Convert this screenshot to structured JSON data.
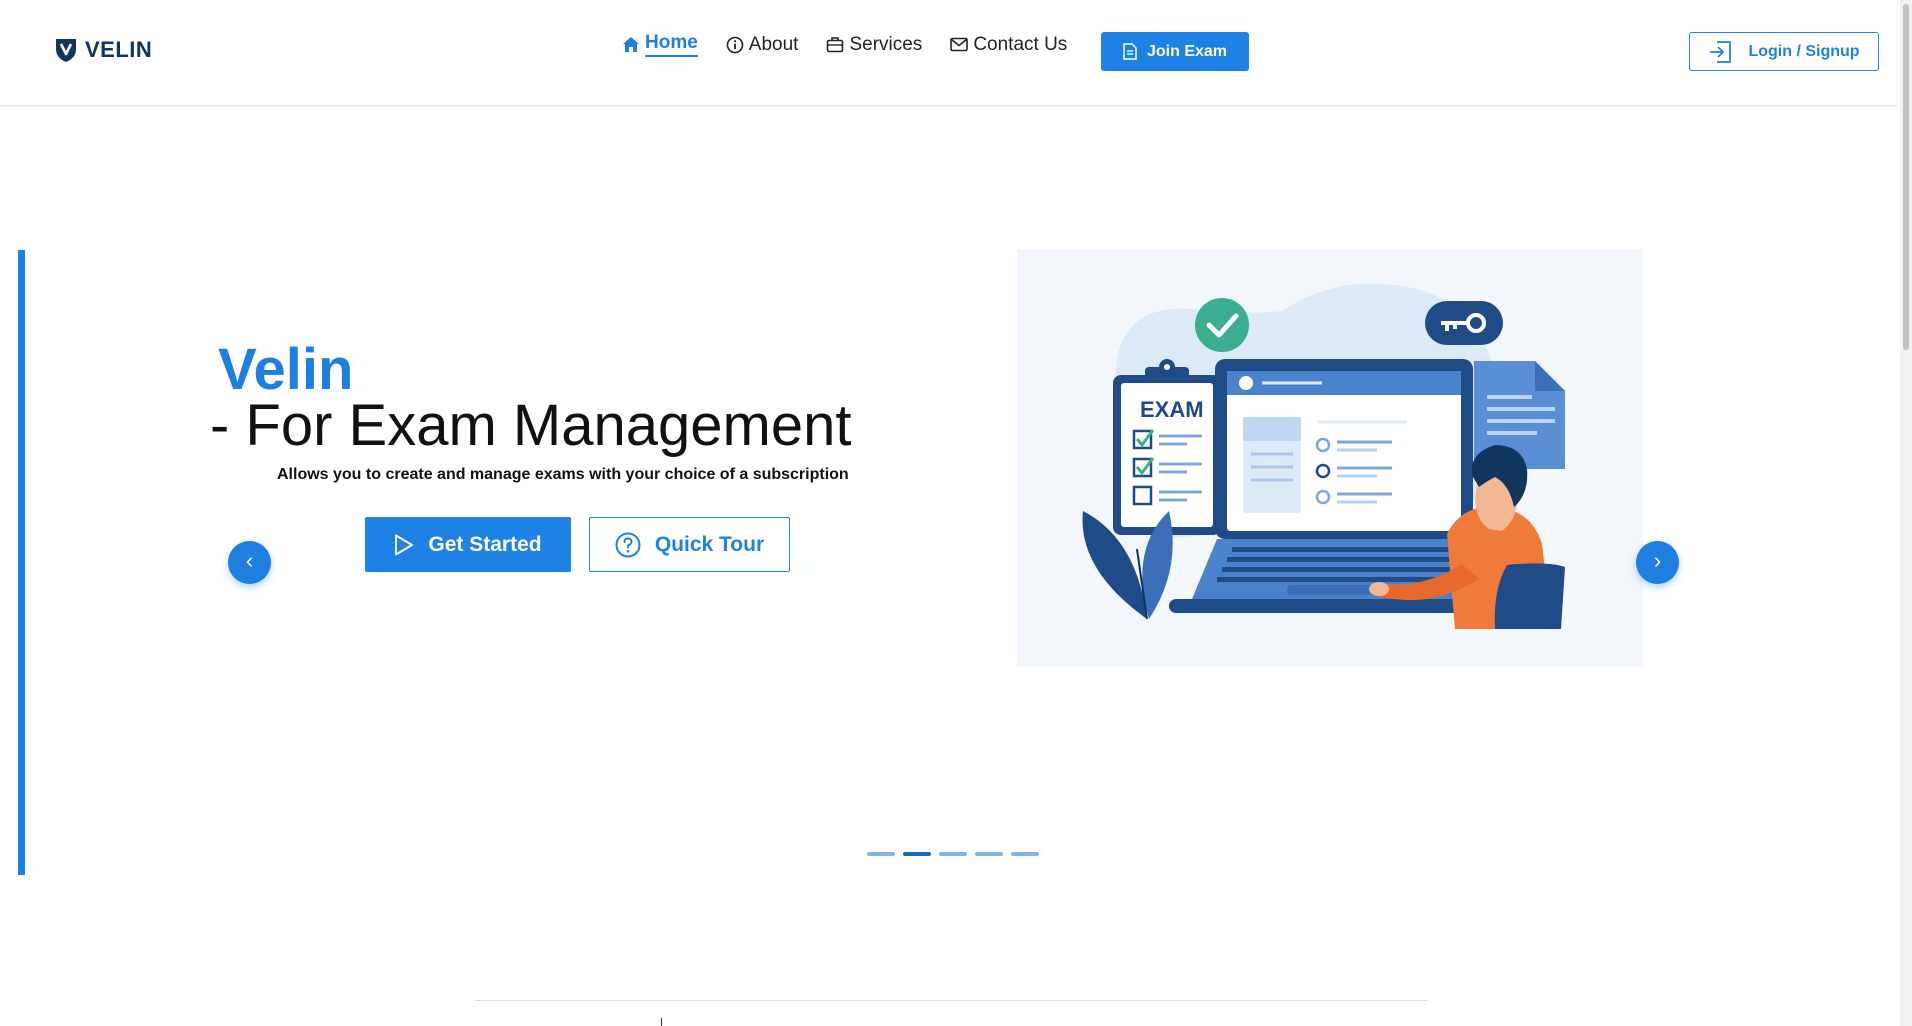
{
  "header": {
    "brand": "VELIN",
    "nav": [
      {
        "label": "Home",
        "icon": "home-icon",
        "active": true
      },
      {
        "label": "About",
        "icon": "info-icon",
        "active": false
      },
      {
        "label": "Services",
        "icon": "briefcase-icon",
        "active": false
      },
      {
        "label": "Contact Us",
        "icon": "envelope-icon",
        "active": false
      }
    ],
    "join_label": "Join Exam",
    "login_label": "Login / Signup"
  },
  "hero": {
    "title": "Velin",
    "subtitle": "- For Exam Management",
    "description": "Allows you to create and manage exams with your choice of a subscription",
    "primary_button": "Get Started",
    "secondary_button": "Quick Tour",
    "illustration_label": "EXAM",
    "prev_glyph": "‹",
    "next_glyph": "›"
  },
  "carousel": {
    "total": 5,
    "active_index": 1
  },
  "colors": {
    "accent": "#1e82e4",
    "brand_dark": "#10365e",
    "illustration_bg": "#f3f6fb",
    "orange": "#f07a3a"
  }
}
